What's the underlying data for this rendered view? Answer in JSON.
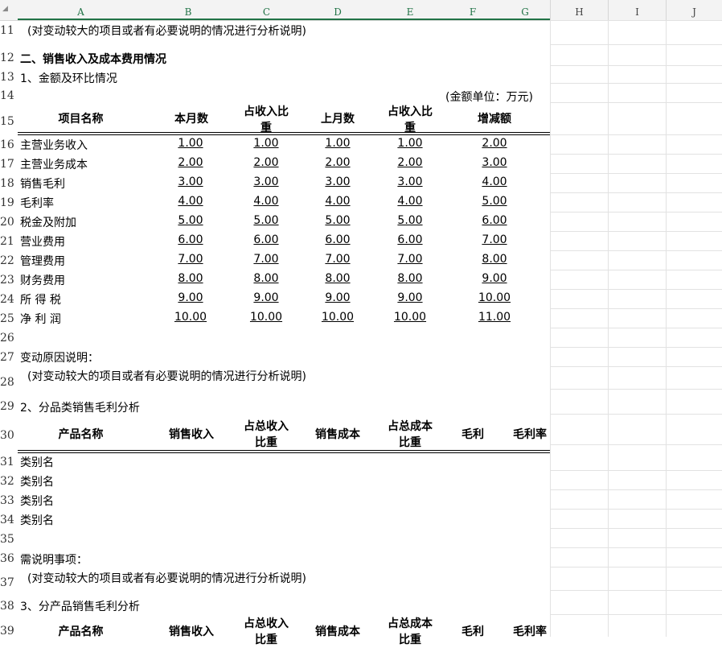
{
  "columns": [
    "A",
    "B",
    "C",
    "D",
    "E",
    "F",
    "G",
    "H",
    "I",
    "J"
  ],
  "row_numbers": [
    "11",
    "12",
    "13",
    "14",
    "15",
    "16",
    "17",
    "18",
    "19",
    "20",
    "21",
    "22",
    "23",
    "24",
    "25",
    "26",
    "27",
    "28",
    "29",
    "30",
    "31",
    "32",
    "33",
    "34",
    "35",
    "36",
    "37",
    "38",
    "39"
  ],
  "section_intro_note": "(对变动较大的项目或者有必要说明的情况进行分析说明)",
  "section2_title": "二、销售收入及成本费用情况",
  "sub1_title": "1、金额及环比情况",
  "unit_note": "(金额单位：万元)",
  "table1": {
    "headers": [
      "项目名称",
      "本月数",
      "占收入比重",
      "上月数",
      "占收入比重",
      "增减额"
    ],
    "rows": [
      {
        "name": "主营业务收入",
        "vals": [
          "1.00",
          "1.00",
          "1.00",
          "1.00",
          "2.00"
        ]
      },
      {
        "name": "主营业务成本",
        "vals": [
          "2.00",
          "2.00",
          "2.00",
          "2.00",
          "3.00"
        ]
      },
      {
        "name": "销售毛利",
        "vals": [
          "3.00",
          "3.00",
          "3.00",
          "3.00",
          "4.00"
        ]
      },
      {
        "name": "毛利率",
        "vals": [
          "4.00",
          "4.00",
          "4.00",
          "4.00",
          "5.00"
        ]
      },
      {
        "name": "税金及附加",
        "vals": [
          "5.00",
          "5.00",
          "5.00",
          "5.00",
          "6.00"
        ]
      },
      {
        "name": "营业费用",
        "vals": [
          "6.00",
          "6.00",
          "6.00",
          "6.00",
          "7.00"
        ]
      },
      {
        "name": "管理费用",
        "vals": [
          "7.00",
          "7.00",
          "7.00",
          "7.00",
          "8.00"
        ]
      },
      {
        "name": "财务费用",
        "vals": [
          "8.00",
          "8.00",
          "8.00",
          "8.00",
          "9.00"
        ]
      },
      {
        "name": "所 得 税",
        "vals": [
          "9.00",
          "9.00",
          "9.00",
          "9.00",
          "10.00"
        ]
      },
      {
        "name": "净 利 润",
        "vals": [
          "10.00",
          "10.00",
          "10.00",
          "10.00",
          "11.00"
        ]
      }
    ]
  },
  "reason_label": "变动原因说明：",
  "reason_note": "(对变动较大的项目或者有必要说明的情况进行分析说明)",
  "sub2_title": "2、分品类销售毛利分析",
  "table2": {
    "headers": [
      "产品名称",
      "销售收入",
      "占总收入比重",
      "销售成本",
      "占总成本比重",
      "毛利",
      "毛利率"
    ],
    "rows": [
      "类别名",
      "类别名",
      "类别名",
      "类别名"
    ]
  },
  "notes_label": "需说明事项：",
  "notes_note": "(对变动较大的项目或者有必要说明的情况进行分析说明)",
  "sub3_title": "3、分产品销售毛利分析",
  "table3": {
    "headers": [
      "产品名称",
      "销售收入",
      "占总收入比重",
      "销售成本",
      "占总成本比重",
      "毛利",
      "毛利率"
    ]
  }
}
